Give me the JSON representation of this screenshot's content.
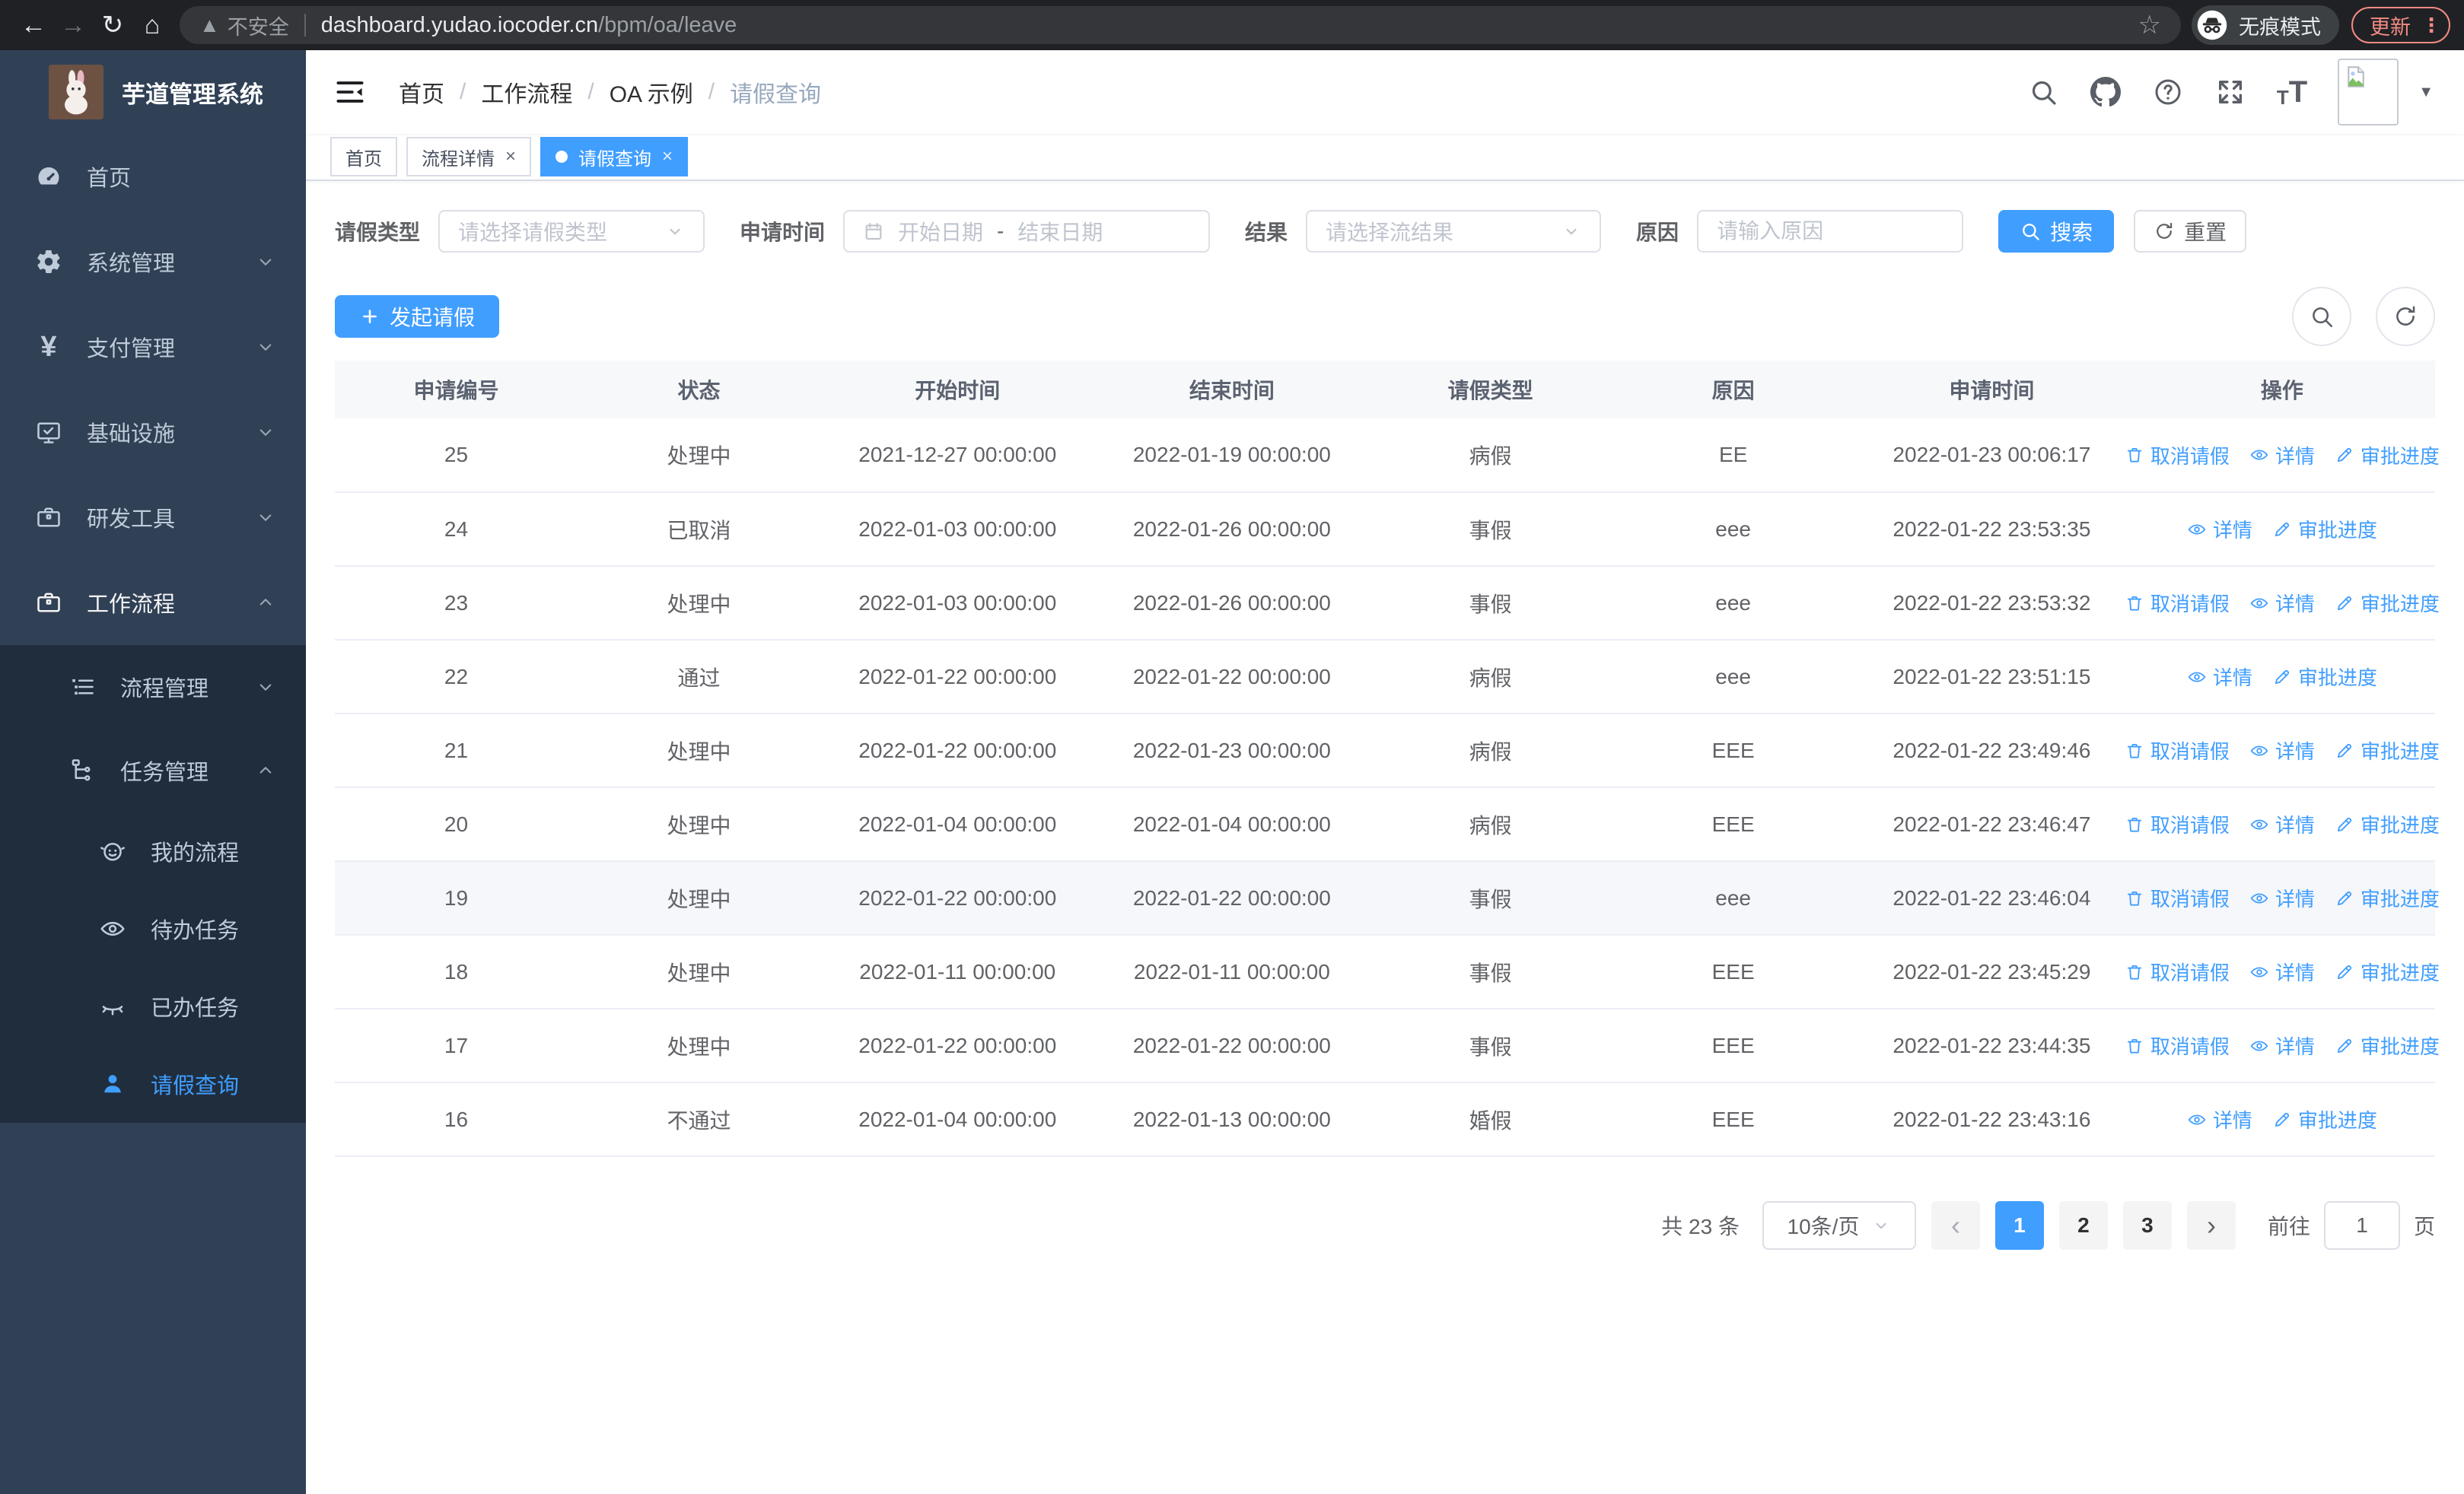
{
  "browser": {
    "security_label": "不安全",
    "url_host": "dashboard.yudao.iocoder.cn",
    "url_path": "/bpm/oa/leave",
    "incognito_label": "无痕模式",
    "update_label": "更新"
  },
  "sidebar": {
    "title": "芋道管理系统",
    "items": [
      {
        "icon": "gauge",
        "label": "首页",
        "level": 1
      },
      {
        "icon": "gear",
        "label": "系统管理",
        "level": 1,
        "chevron": "down"
      },
      {
        "icon": "yen",
        "label": "支付管理",
        "level": 1,
        "chevron": "down"
      },
      {
        "icon": "monitor",
        "label": "基础设施",
        "level": 1,
        "chevron": "down"
      },
      {
        "icon": "briefcase",
        "label": "研发工具",
        "level": 1,
        "chevron": "down"
      },
      {
        "icon": "briefcase",
        "label": "工作流程",
        "level": 1,
        "chevron": "up",
        "parent_active": true
      },
      {
        "icon": "list-tree",
        "label": "流程管理",
        "level": 2,
        "chevron": "down",
        "submenu": true
      },
      {
        "icon": "flow",
        "label": "任务管理",
        "level": 2,
        "chevron": "up",
        "submenu": true
      },
      {
        "icon": "robot",
        "label": "我的流程",
        "level": 3,
        "submenu": true
      },
      {
        "icon": "eye",
        "label": "待办任务",
        "level": 3,
        "submenu": true
      },
      {
        "icon": "eye-closed",
        "label": "已办任务",
        "level": 3,
        "submenu": true
      },
      {
        "icon": "user",
        "label": "请假查询",
        "level": 3,
        "submenu": true,
        "active": true
      }
    ]
  },
  "header": {
    "breadcrumb": [
      "首页",
      "工作流程",
      "OA 示例",
      "请假查询"
    ]
  },
  "tabs": [
    {
      "label": "首页"
    },
    {
      "label": "流程详情",
      "closable": true
    },
    {
      "label": "请假查询",
      "closable": true,
      "active": true
    }
  ],
  "filters": {
    "leave_type_label": "请假类型",
    "leave_type_placeholder": "请选择请假类型",
    "apply_time_label": "申请时间",
    "start_date_placeholder": "开始日期",
    "range_separator": "-",
    "end_date_placeholder": "结束日期",
    "result_label": "结果",
    "result_placeholder": "请选择流结果",
    "reason_label": "原因",
    "reason_placeholder": "请输入原因",
    "search_label": "搜索",
    "reset_label": "重置"
  },
  "toolbar": {
    "create_label": "发起请假"
  },
  "table": {
    "columns": [
      "申请编号",
      "状态",
      "开始时间",
      "结束时间",
      "请假类型",
      "原因",
      "申请时间",
      "操作"
    ],
    "action_labels": {
      "cancel": "取消请假",
      "detail": "详情",
      "progress": "审批进度"
    },
    "rows": [
      {
        "id": "25",
        "status": "处理中",
        "start": "2021-12-27 00:00:00",
        "end": "2022-01-19 00:00:00",
        "type": "病假",
        "reason": "EE",
        "apply_time": "2022-01-23 00:06:17",
        "actions": [
          "cancel",
          "detail",
          "progress"
        ]
      },
      {
        "id": "24",
        "status": "已取消",
        "start": "2022-01-03 00:00:00",
        "end": "2022-01-26 00:00:00",
        "type": "事假",
        "reason": "eee",
        "apply_time": "2022-01-22 23:53:35",
        "actions": [
          "detail",
          "progress"
        ]
      },
      {
        "id": "23",
        "status": "处理中",
        "start": "2022-01-03 00:00:00",
        "end": "2022-01-26 00:00:00",
        "type": "事假",
        "reason": "eee",
        "apply_time": "2022-01-22 23:53:32",
        "actions": [
          "cancel",
          "detail",
          "progress"
        ]
      },
      {
        "id": "22",
        "status": "通过",
        "start": "2022-01-22 00:00:00",
        "end": "2022-01-22 00:00:00",
        "type": "病假",
        "reason": "eee",
        "apply_time": "2022-01-22 23:51:15",
        "actions": [
          "detail",
          "progress"
        ]
      },
      {
        "id": "21",
        "status": "处理中",
        "start": "2022-01-22 00:00:00",
        "end": "2022-01-23 00:00:00",
        "type": "病假",
        "reason": "EEE",
        "apply_time": "2022-01-22 23:49:46",
        "actions": [
          "cancel",
          "detail",
          "progress"
        ]
      },
      {
        "id": "20",
        "status": "处理中",
        "start": "2022-01-04 00:00:00",
        "end": "2022-01-04 00:00:00",
        "type": "病假",
        "reason": "EEE",
        "apply_time": "2022-01-22 23:46:47",
        "actions": [
          "cancel",
          "detail",
          "progress"
        ]
      },
      {
        "id": "19",
        "status": "处理中",
        "start": "2022-01-22 00:00:00",
        "end": "2022-01-22 00:00:00",
        "type": "事假",
        "reason": "eee",
        "apply_time": "2022-01-22 23:46:04",
        "actions": [
          "cancel",
          "detail",
          "progress"
        ],
        "highlighted": true
      },
      {
        "id": "18",
        "status": "处理中",
        "start": "2022-01-11 00:00:00",
        "end": "2022-01-11 00:00:00",
        "type": "事假",
        "reason": "EEE",
        "apply_time": "2022-01-22 23:45:29",
        "actions": [
          "cancel",
          "detail",
          "progress"
        ]
      },
      {
        "id": "17",
        "status": "处理中",
        "start": "2022-01-22 00:00:00",
        "end": "2022-01-22 00:00:00",
        "type": "事假",
        "reason": "EEE",
        "apply_time": "2022-01-22 23:44:35",
        "actions": [
          "cancel",
          "detail",
          "progress"
        ]
      },
      {
        "id": "16",
        "status": "不通过",
        "start": "2022-01-04 00:00:00",
        "end": "2022-01-13 00:00:00",
        "type": "婚假",
        "reason": "EEE",
        "apply_time": "2022-01-22 23:43:16",
        "actions": [
          "detail",
          "progress"
        ]
      }
    ]
  },
  "pagination": {
    "total": "共 23 条",
    "page_size": "10条/页",
    "pages": [
      "1",
      "2",
      "3"
    ],
    "active_page": "1",
    "goto_label": "前往",
    "goto_value": "1",
    "unit_label": "页"
  },
  "colors": {
    "accent": "#409eff",
    "sidebar": "#304156",
    "submenu": "#1f2d3d",
    "update_button": "#f28b82"
  }
}
